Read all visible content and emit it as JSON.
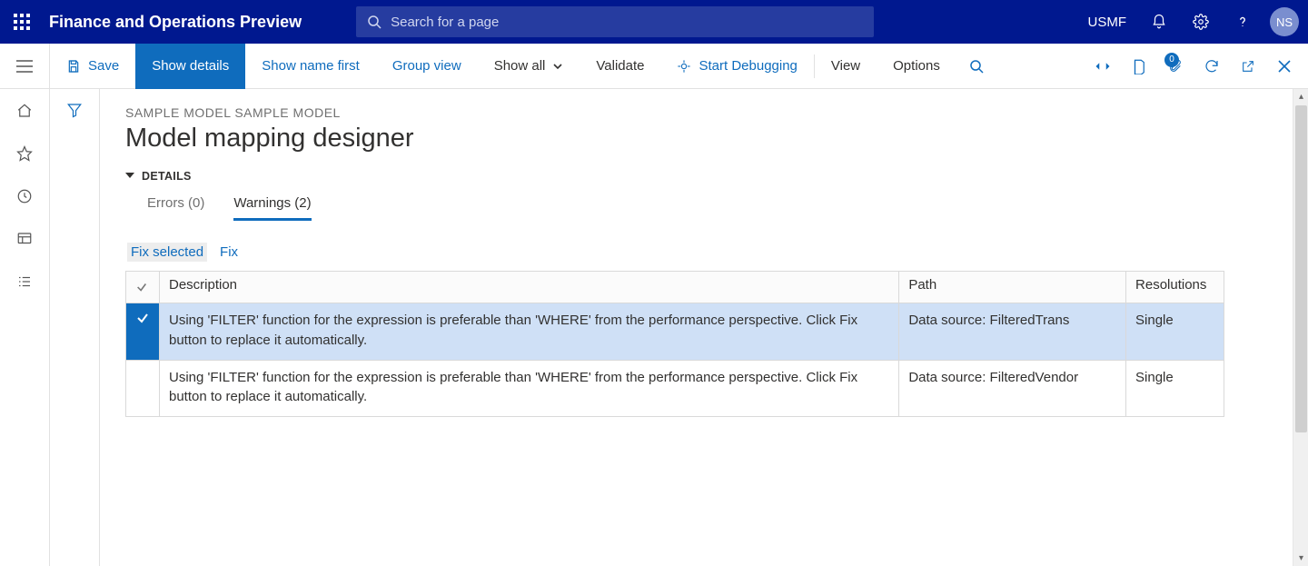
{
  "topbar": {
    "app_title": "Finance and Operations Preview",
    "search_placeholder": "Search for a page",
    "company": "USMF",
    "avatar_initials": "NS"
  },
  "actionbar": {
    "save": "Save",
    "show_details": "Show details",
    "show_name_first": "Show name first",
    "group_view": "Group view",
    "show_all": "Show all",
    "validate": "Validate",
    "start_debugging": "Start Debugging",
    "view": "View",
    "options": "Options",
    "attachment_count": "0"
  },
  "page": {
    "breadcrumb": "SAMPLE MODEL SAMPLE MODEL",
    "title": "Model mapping designer",
    "section_label": "DETAILS"
  },
  "tabs": {
    "errors": "Errors (0)",
    "warnings": "Warnings (2)"
  },
  "grid": {
    "actions": {
      "fix_selected": "Fix selected",
      "fix": "Fix"
    },
    "headers": {
      "description": "Description",
      "path": "Path",
      "resolutions": "Resolutions"
    },
    "rows": [
      {
        "selected": true,
        "description": "Using 'FILTER' function for the expression is preferable than 'WHERE' from the performance perspective. Click Fix button to replace it automatically.",
        "path": "Data source: FilteredTrans",
        "resolutions": "Single"
      },
      {
        "selected": false,
        "description": "Using 'FILTER' function for the expression is preferable than 'WHERE' from the performance perspective. Click Fix button to replace it automatically.",
        "path": "Data source: FilteredVendor",
        "resolutions": "Single"
      }
    ]
  }
}
